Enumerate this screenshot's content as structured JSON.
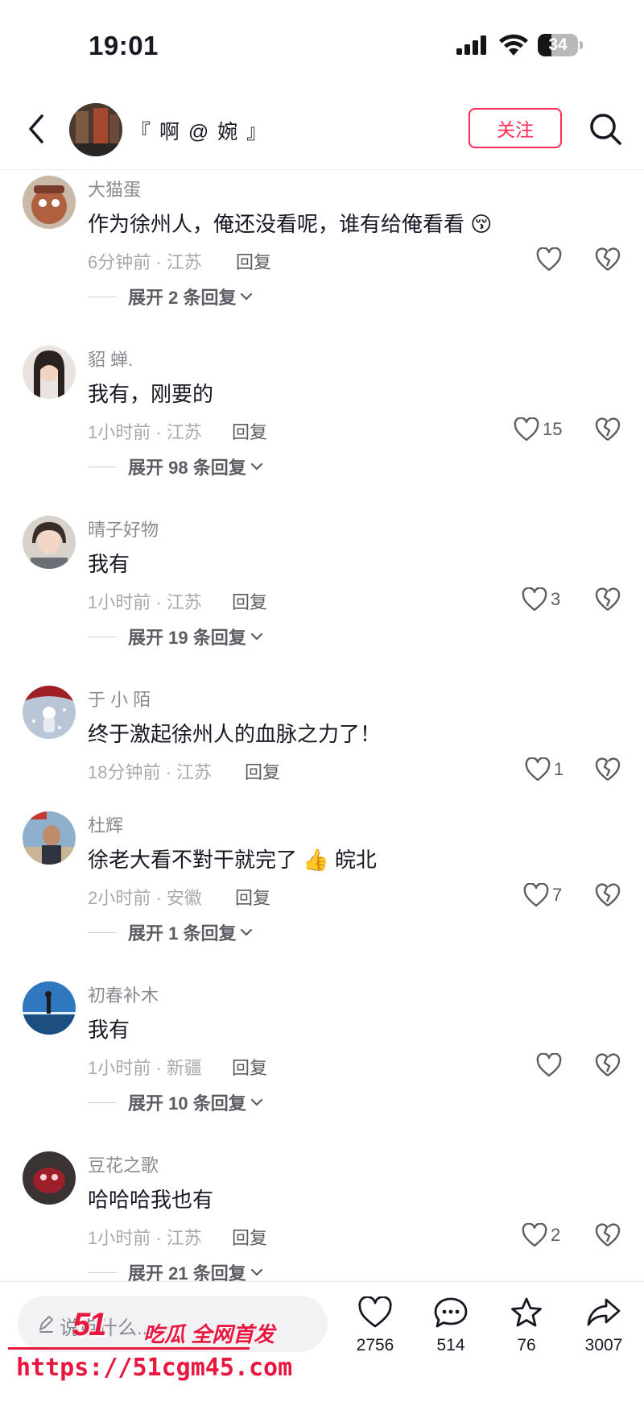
{
  "status_bar": {
    "time": "19:01",
    "battery_level": "34",
    "battery_fraction": 0.34
  },
  "header": {
    "author_name": "『 啊 @ 婉 』",
    "follow_label": "关注"
  },
  "comments": [
    {
      "username": "大猫蛋",
      "text": "作为徐州人，俺还没看呢，谁有给俺看看",
      "emoji": "😚",
      "meta": "6分钟前 · 江苏",
      "reply": "回复",
      "likes": "",
      "expand": "展开 2 条回复"
    },
    {
      "username": "貂 蝉.",
      "text": "我有，刚要的",
      "emoji": "",
      "meta": "1小时前 · 江苏",
      "reply": "回复",
      "likes": "15",
      "expand": "展开 98 条回复"
    },
    {
      "username": "晴子好物",
      "text": "我有",
      "emoji": "",
      "meta": "1小时前 · 江苏",
      "reply": "回复",
      "likes": "3",
      "expand": "展开 19 条回复"
    },
    {
      "username": "于 小 陌",
      "text": "终于激起徐州人的血脉之力了！",
      "emoji": "",
      "meta": "18分钟前 · 江苏",
      "reply": "回复",
      "likes": "1",
      "expand": ""
    },
    {
      "username": "杜辉",
      "text": "徐老大看不對干就完了",
      "emoji": "👍",
      "text_suffix": "皖北",
      "meta": "2小时前 · 安徽",
      "reply": "回复",
      "likes": "7",
      "expand": "展开 1 条回复"
    },
    {
      "username": "初春补木",
      "text": "我有",
      "emoji": "",
      "meta": "1小时前 · 新疆",
      "reply": "回复",
      "likes": "",
      "expand": "展开 10 条回复"
    },
    {
      "username": "豆花之歌",
      "text": "哈哈哈我也有",
      "emoji": "",
      "meta": "1小时前 · 江苏",
      "reply": "回复",
      "likes": "2",
      "expand": "展开 21 条回复"
    }
  ],
  "bottom_bar": {
    "input_placeholder": "说点什么...",
    "like_count": "2756",
    "comment_count": "514",
    "favorite_count": "76",
    "share_count": "3007"
  },
  "watermark": {
    "logo": "51",
    "brand": "吃瓜 全网首发",
    "url": "https://51cgm45.com"
  },
  "colors": {
    "accent": "#fe2c55",
    "text": "#161823",
    "secondary": "#8a8b91",
    "watermark": "#e8173f"
  }
}
